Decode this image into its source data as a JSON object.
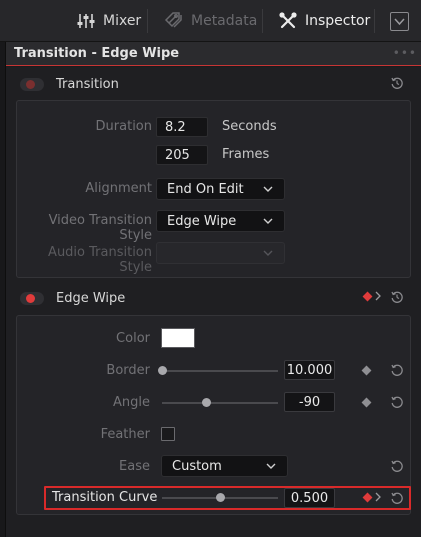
{
  "toolbar": {
    "mixer_label": "Mixer",
    "metadata_label": "Metadata",
    "inspector_label": "Inspector",
    "icons": {
      "mixer": "sliders-icon",
      "metadata": "tags-icon",
      "inspector": "tools-icon",
      "panel": "chevron-down-box-icon"
    }
  },
  "panel_title": "Transition - Edge Wipe",
  "panel_menu": "•••",
  "transition_section": {
    "label": "Transition",
    "duration_label": "Duration",
    "duration_value": "8.2",
    "duration_unit": "Seconds",
    "frames_value": "205",
    "frames_unit": "Frames",
    "alignment_label": "Alignment",
    "alignment_value": "End On Edit",
    "video_style_label": "Video Transition Style",
    "video_style_value": "Edge Wipe",
    "audio_style_label": "Audio Transition Style",
    "audio_style_value": ""
  },
  "edge_wipe_section": {
    "label": "Edge Wipe",
    "color_label": "Color",
    "color_value": "#ffffff",
    "border_label": "Border",
    "border_value": "10.000",
    "border_slider": 0.0,
    "angle_label": "Angle",
    "angle_value": "-90",
    "angle_slider": 0.38,
    "feather_label": "Feather",
    "feather_checked": false,
    "ease_label": "Ease",
    "ease_value": "Custom",
    "curve_label": "Transition Curve",
    "curve_value": "0.500",
    "curve_slider": 0.5
  },
  "colors": {
    "accent": "#e03b3b",
    "background": "#1f1f22",
    "highlight": "#d92a2a"
  }
}
